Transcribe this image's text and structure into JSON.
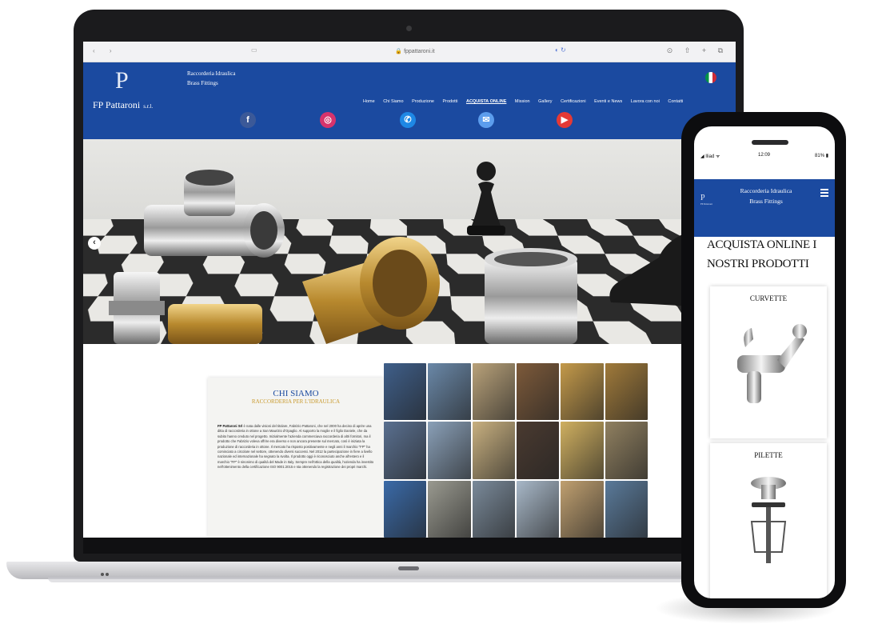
{
  "browser": {
    "nav_arrows": "‹ ›",
    "sidebar_icon": "sidebar-icon",
    "url": "🔒 fppattaroni.it",
    "reload_icon": "reload-icon",
    "actions": "⊙ ⇧ + ⧉"
  },
  "site": {
    "logo_mark": "P",
    "logo_name": "FP Pattaroni",
    "logo_suffix": "s.r.l.",
    "tagline_line1": "Raccorderia Idraulica",
    "tagline_line2": "Brass Fittings",
    "nav": [
      {
        "label": "Home",
        "active": false
      },
      {
        "label": "Chi Siamo",
        "active": false
      },
      {
        "label": "Produzione",
        "active": false
      },
      {
        "label": "Prodotti",
        "active": false
      },
      {
        "label": "ACQUISTA ONLINE",
        "active": true
      },
      {
        "label": "Mission",
        "active": false
      },
      {
        "label": "Gallery",
        "active": false
      },
      {
        "label": "Certificazioni",
        "active": false
      },
      {
        "label": "Eventi e News",
        "active": false
      },
      {
        "label": "Lavora con noi",
        "active": false
      },
      {
        "label": "Contatti",
        "active": false
      }
    ],
    "social": [
      {
        "icon": "facebook-icon",
        "glyph": "f",
        "color": "#3b5998"
      },
      {
        "icon": "instagram-icon",
        "glyph": "◎",
        "color": "#d6336c"
      },
      {
        "icon": "phone-icon",
        "glyph": "✆",
        "color": "#1e88e5"
      },
      {
        "icon": "mail-icon",
        "glyph": "✉",
        "color": "#5c9ded"
      },
      {
        "icon": "youtube-icon",
        "glyph": "▶",
        "color": "#e53935"
      }
    ],
    "hero_prev": "‹",
    "chi_siamo": {
      "title": "CHI SIAMO",
      "subtitle": "RACCORDERIA PER L'IDRAULICA",
      "company": "FP Pattaroni Srl",
      "body": " è nata dalle visioni del titolare, Fabrizio Pattaroni, che nel 2000 ha deciso di aprire una ditta di raccorderia in ottone a San Maurizio d'Opaglio. Al supporto la moglie e il figlio Daniele, che da subito hanno creduto nel progetto. Inizialmente l'azienda commerciava raccorderia di altri fornitori, ma il prodotto che Fabrizio voleva offrire era diverso e non ancora presente sul mercato, così è iniziata la produzione di raccorderia in ottone. Il mercato ha risposto positivamente e negli anni il marchio \"FP\" ha cominciato a circolare nel settore, ottenendo diversi successi. Nel 2012 la partecipazione in fiere a livello nazionale ed internazionale ha segnato la svolta. Il prodotto oggi è riconosciuto anche all'estero e il marchio \"FP\" è sinonimo di qualità del Made in Italy. Sempre nell'ottica della qualità, l'azienda ha investito nell'ottenimento della certificazione ISO 9001:2015 e sta ottenendo la registrazione dei propri marchi."
    },
    "gallery_colors": [
      "#3f5f8a",
      "#6a88a8",
      "#b9a27a",
      "#7d5a3a",
      "#c49a4a",
      "#a07a3a",
      "#5a7090",
      "#8aa0b8",
      "#c8b080",
      "#4a3a30",
      "#d0b060",
      "#908060",
      "#3a6aa8",
      "#9a9a90",
      "#7a8a9a",
      "#a8b8c8",
      "#c0a070",
      "#5a7a9a"
    ]
  },
  "phone": {
    "carrier": "◢ Iliad ᯤ",
    "time": "12:09",
    "battery": "81% ▮",
    "tagline_line1": "Raccorderia Idraulica",
    "tagline_line2": "Brass Fittings",
    "logo_mark": "P",
    "logo_sub": "FP Pattaroni",
    "menu_icon": "hamburger-icon",
    "heading": "ACQUISTA ONLINE I NOSTRI PRODOTTI",
    "products": [
      {
        "label": "CURVETTE"
      },
      {
        "label": "PILETTE"
      }
    ]
  }
}
